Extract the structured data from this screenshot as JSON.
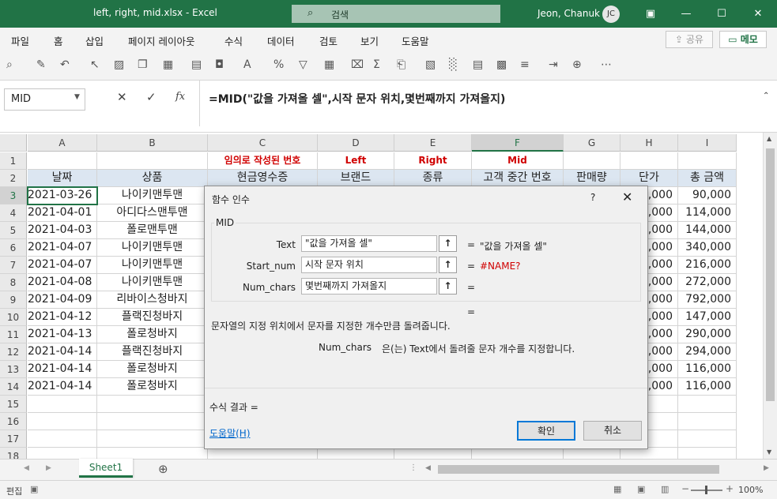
{
  "window": {
    "title": "left, right, mid.xlsx  -  Excel",
    "search_placeholder": "검색",
    "user_name": "Jeon, Chanuk",
    "user_initials": "JC"
  },
  "menu": [
    "파일",
    "홈",
    "삽입",
    "페이지 레이아웃",
    "수식",
    "데이터",
    "검토",
    "보기",
    "도움말"
  ],
  "share_label": "공유",
  "memo_label": "메모",
  "formula_bar": {
    "name_box": "MID",
    "formula": "=MID(\"값을 가져올 셀\",시작 문자 위치,몇번째까지 가져올지)"
  },
  "columns": [
    "A",
    "B",
    "C",
    "D",
    "E",
    "F",
    "G",
    "H",
    "I"
  ],
  "selected_column": "F",
  "row_numbers": [
    "1",
    "2",
    "3",
    "4",
    "5",
    "6",
    "7",
    "8",
    "9",
    "10",
    "11",
    "12",
    "13",
    "14",
    "15",
    "16",
    "17",
    "18"
  ],
  "selected_row": "3",
  "row1_labels": {
    "c": "임의로 작성된 번호",
    "d": "Left",
    "e": "Right",
    "f": "Mid"
  },
  "headers": [
    "날짜",
    "상품",
    "현금영수증",
    "브랜드",
    "종류",
    "고객 중간 번호",
    "판매량",
    "단가",
    "총 금액"
  ],
  "rows": [
    {
      "date": "2021-03-26",
      "product": "나이키맨투맨",
      "price_tail": "5,000",
      "total": "90,000"
    },
    {
      "date": "2021-04-01",
      "product": "아디다스맨투맨",
      "price_tail": "3,000",
      "total": "114,000"
    },
    {
      "date": "2021-04-03",
      "product": "폴로맨투맨",
      "price_tail": "2,000",
      "total": "144,000"
    },
    {
      "date": "2021-04-07",
      "product": "나이키맨투맨",
      "price_tail": "5,000",
      "total": "340,000"
    },
    {
      "date": "2021-04-07",
      "product": "나이키맨투맨",
      "price_tail": "2,000",
      "total": "216,000"
    },
    {
      "date": "2021-04-08",
      "product": "나이키맨투맨",
      "price_tail": "3,000",
      "total": "272,000"
    },
    {
      "date": "2021-04-09",
      "product": "리바이스청바지",
      "price_tail": "3,000",
      "total": "792,000"
    },
    {
      "date": "2021-04-12",
      "product": "플랙진청바지",
      "price_tail": "9,000",
      "total": "147,000"
    },
    {
      "date": "2021-04-13",
      "product": "폴로청바지",
      "price_tail": "3,000",
      "total": "290,000"
    },
    {
      "date": "2021-04-14",
      "product": "플랙진청바지",
      "price_tail": "9,000",
      "total": "294,000"
    },
    {
      "date": "2021-04-14",
      "product": "폴로청바지",
      "price_tail": "3,000",
      "total": "116,000"
    },
    {
      "date": "2021-04-14",
      "product": "폴로청바지",
      "price_tail": "3,000",
      "total": "116,000"
    }
  ],
  "sheet_tab": "Sheet1",
  "status": {
    "mode": "편집",
    "zoom": "100%"
  },
  "dialog": {
    "title": "함수 인수",
    "help_glyph": "?",
    "function_name": "MID",
    "args": [
      {
        "label": "Text",
        "value": "\"값을 가져올 셀\"",
        "result": "\"값을 가져올 셀\"",
        "error": false
      },
      {
        "label": "Start_num",
        "value": "시작 문자 위치",
        "result": "#NAME?",
        "error": true
      },
      {
        "label": "Num_chars",
        "value": "몇번째까지 가져올지",
        "result": "",
        "error": false
      }
    ],
    "equals": "=",
    "description": "문자열의 지정 위치에서 문자를 지정한 개수만큼 돌려줍니다.",
    "arg_help_name": "Num_chars",
    "arg_help_text": "은(는) Text에서 돌려줄 문자 개수를 지정합니다.",
    "result_label": "수식 결과 =",
    "help_link": "도움말(H)",
    "ok_label": "확인",
    "cancel_label": "취소"
  },
  "colors": {
    "accent": "#217346",
    "error": "#d00000",
    "header_fill": "#dce6f1"
  }
}
